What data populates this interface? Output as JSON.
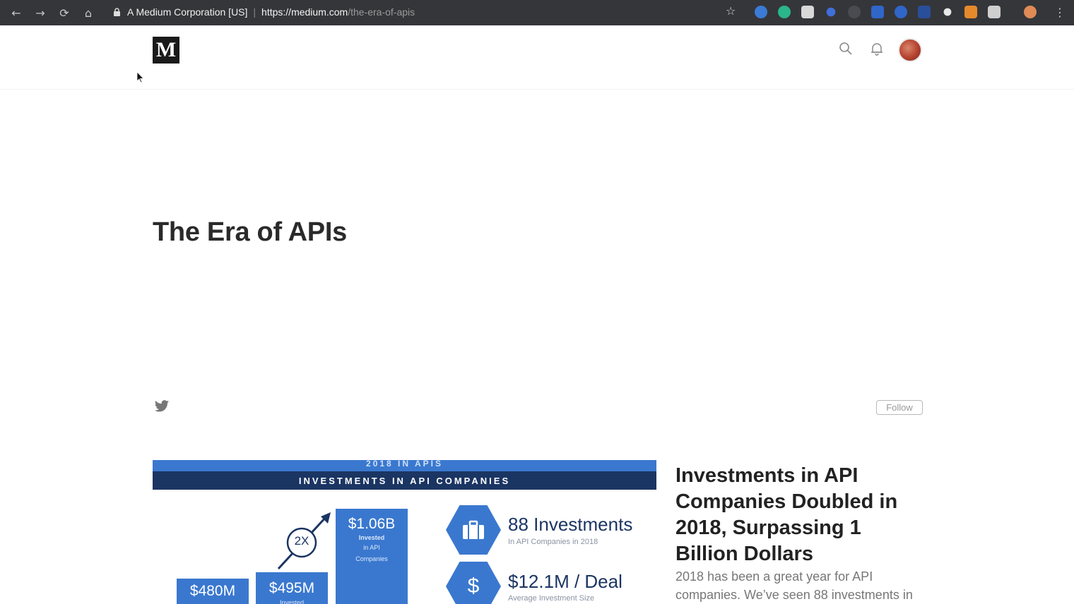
{
  "browser": {
    "back": "←",
    "forward": "→",
    "reload": "⟳",
    "home": "⌂",
    "site_identity": "A Medium Corporation [US]",
    "url_host": "https://medium.com",
    "url_path": "/the-era-of-apis",
    "bookmark_icon": "star-icon",
    "menu": "⋮"
  },
  "header": {
    "logo": "M",
    "search_icon": "search-icon",
    "notifications_icon": "bell-icon",
    "avatar": "avatar"
  },
  "publication": {
    "title": "The Era of APIs",
    "social_icon": "twitter-icon",
    "follow_label": "Follow"
  },
  "featured": {
    "infographic": {
      "kicker": "2018 IN APIS",
      "heading": "INVESTMENTS IN API COMPANIES",
      "bars": [
        {
          "value": "$480M",
          "sub": ""
        },
        {
          "value": "$495M",
          "sub": "Invested"
        },
        {
          "value": "$1.06B",
          "sub_1": "Invested",
          "sub_2": "in API",
          "sub_3": "Companies"
        }
      ],
      "multiplier": "2X",
      "stats": [
        {
          "icon": "briefcase-icon",
          "value": "88 Investments",
          "sub": "In API Companies in 2018"
        },
        {
          "icon": "dollar-icon",
          "value": "$12.1M / Deal",
          "sub": "Average Investment Size"
        }
      ]
    },
    "title": "Investments in API Companies Doubled in 2018, Surpassing 1 Billion Dollars",
    "excerpt": "2018 has been a great year for API companies. We’ve seen 88 investments in"
  },
  "colors": {
    "accent_blue": "#3a78cf",
    "navy": "#1b3563",
    "chrome_bg": "#35363a"
  }
}
